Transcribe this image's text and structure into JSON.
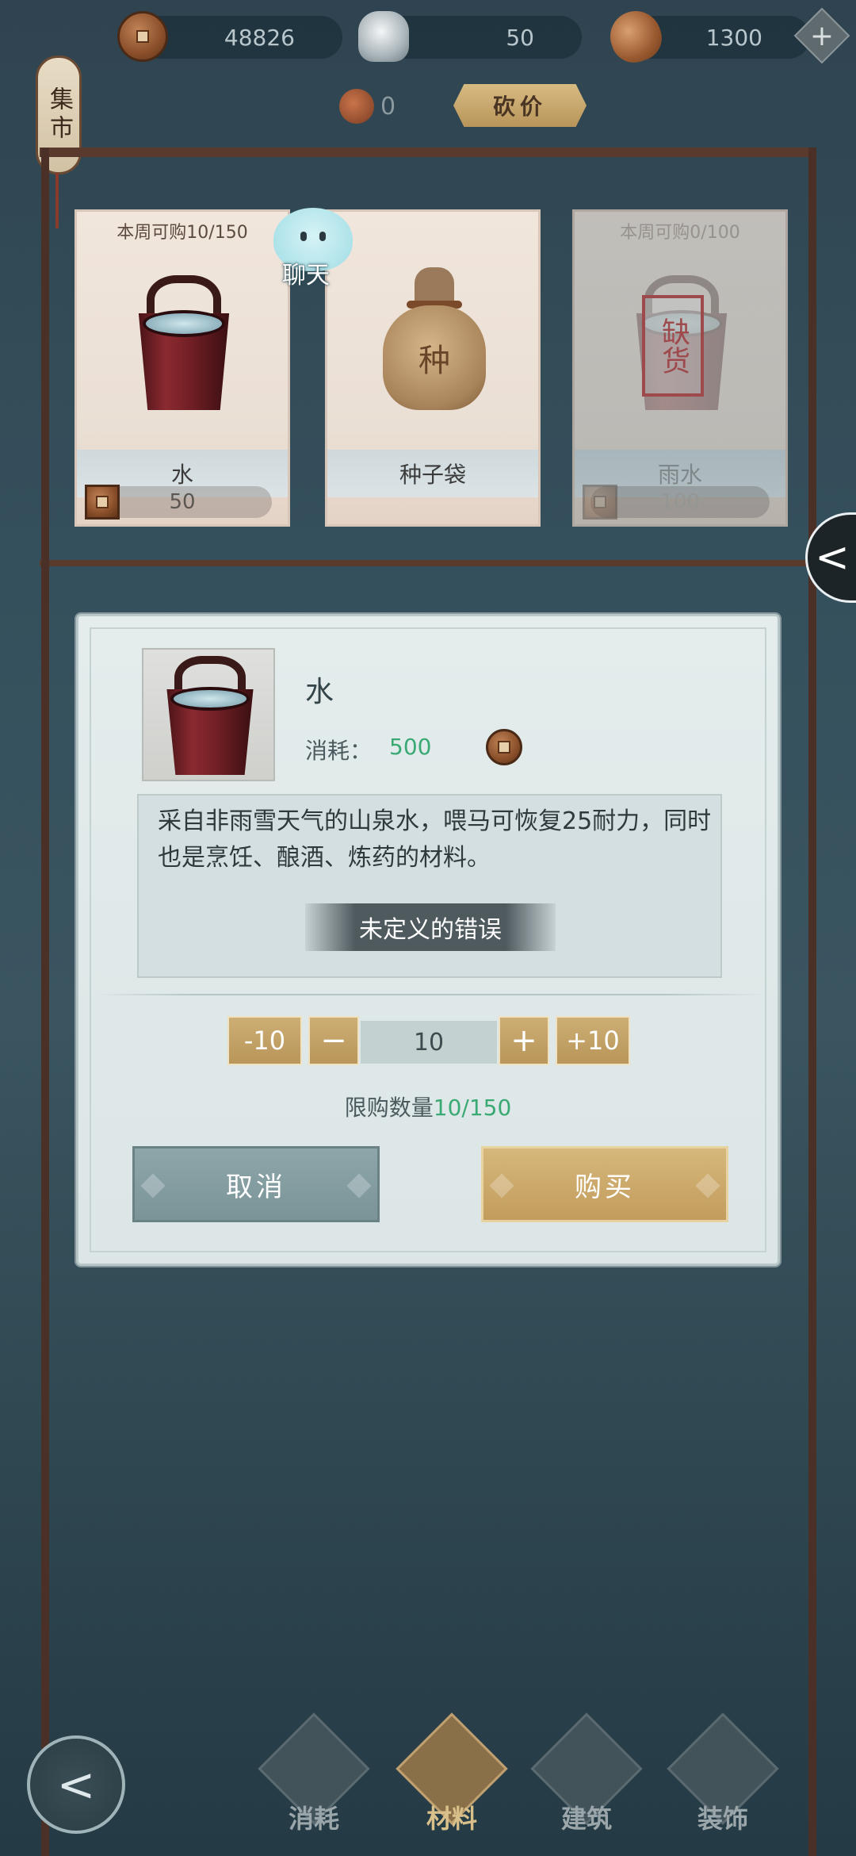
{
  "currency": {
    "copper": "48826",
    "silver": "50",
    "shell": "1300"
  },
  "market_sign": "集市",
  "bargain": {
    "count": "0",
    "button": "砍价"
  },
  "shelf": {
    "items": [
      {
        "limit": "本周可购10/150",
        "name": "水",
        "price": "50"
      },
      {
        "limit": "",
        "name": "种子袋",
        "price": ""
      },
      {
        "limit": "本周可购0/100",
        "name": "雨水",
        "price": "100",
        "stamp": "缺货"
      }
    ]
  },
  "chat": {
    "label": "聊天"
  },
  "side_tab_glyph": "<",
  "modal": {
    "title": "水",
    "cost_label": "消耗：",
    "cost_value": "500",
    "description": "采自非雨雪天气的山泉水，喂马可恢复25耐力，同时也是烹饪、酿酒、炼药的材料。",
    "error": "未定义的错误",
    "minus10": "-10",
    "minus": "−",
    "quantity": "10",
    "plus": "+",
    "plus10": "+10",
    "limit_label": "限购数量",
    "limit_value": "10/150",
    "cancel": "取消",
    "buy": "购买"
  },
  "seed_glyph": "种",
  "nav": {
    "back_glyph": "<",
    "tabs": [
      {
        "label": "消耗"
      },
      {
        "label": "材料"
      },
      {
        "label": "建筑"
      },
      {
        "label": "装饰"
      }
    ]
  }
}
